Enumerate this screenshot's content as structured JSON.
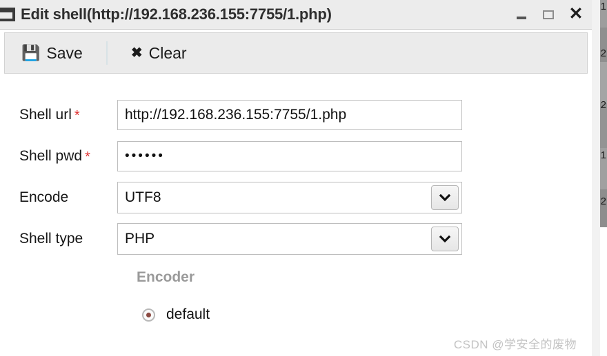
{
  "window": {
    "title": "Edit shell(http://192.168.236.155:7755/1.php)",
    "app_icon": "window-icon",
    "controls": {
      "minimize": "–",
      "maximize": "□",
      "close": "✕"
    }
  },
  "toolbar": {
    "save_label": "Save",
    "save_icon": "floppy-disk-icon",
    "clear_label": "Clear",
    "clear_icon": "cross-icon"
  },
  "form": {
    "fields": [
      {
        "label": "Shell url",
        "required": true,
        "required_marker": "*",
        "value": "http://192.168.236.155:7755/1.php",
        "type": "text"
      },
      {
        "label": "Shell pwd",
        "required": true,
        "required_marker": "*",
        "value": "••••••",
        "type": "password"
      },
      {
        "label": "Encode",
        "required": false,
        "required_marker": "",
        "value": "UTF8",
        "type": "select"
      },
      {
        "label": "Shell type",
        "required": false,
        "required_marker": "",
        "value": "PHP",
        "type": "select"
      }
    ]
  },
  "encoder": {
    "title": "Encoder",
    "options": [
      {
        "label": "default",
        "selected": true
      }
    ]
  },
  "watermark": {
    "text": "CSDN @学安全的废物"
  },
  "background_window": {
    "digits": [
      "1",
      "2",
      "2",
      "1",
      "2"
    ]
  },
  "colors": {
    "titlebar_bg": "#ececec",
    "toolbar_bg": "#ebebeb",
    "required_marker": "#e03131",
    "encoder_title": "#9a9a9a",
    "radio_dot": "#8b4a42",
    "watermark": "#c3c3c3"
  }
}
